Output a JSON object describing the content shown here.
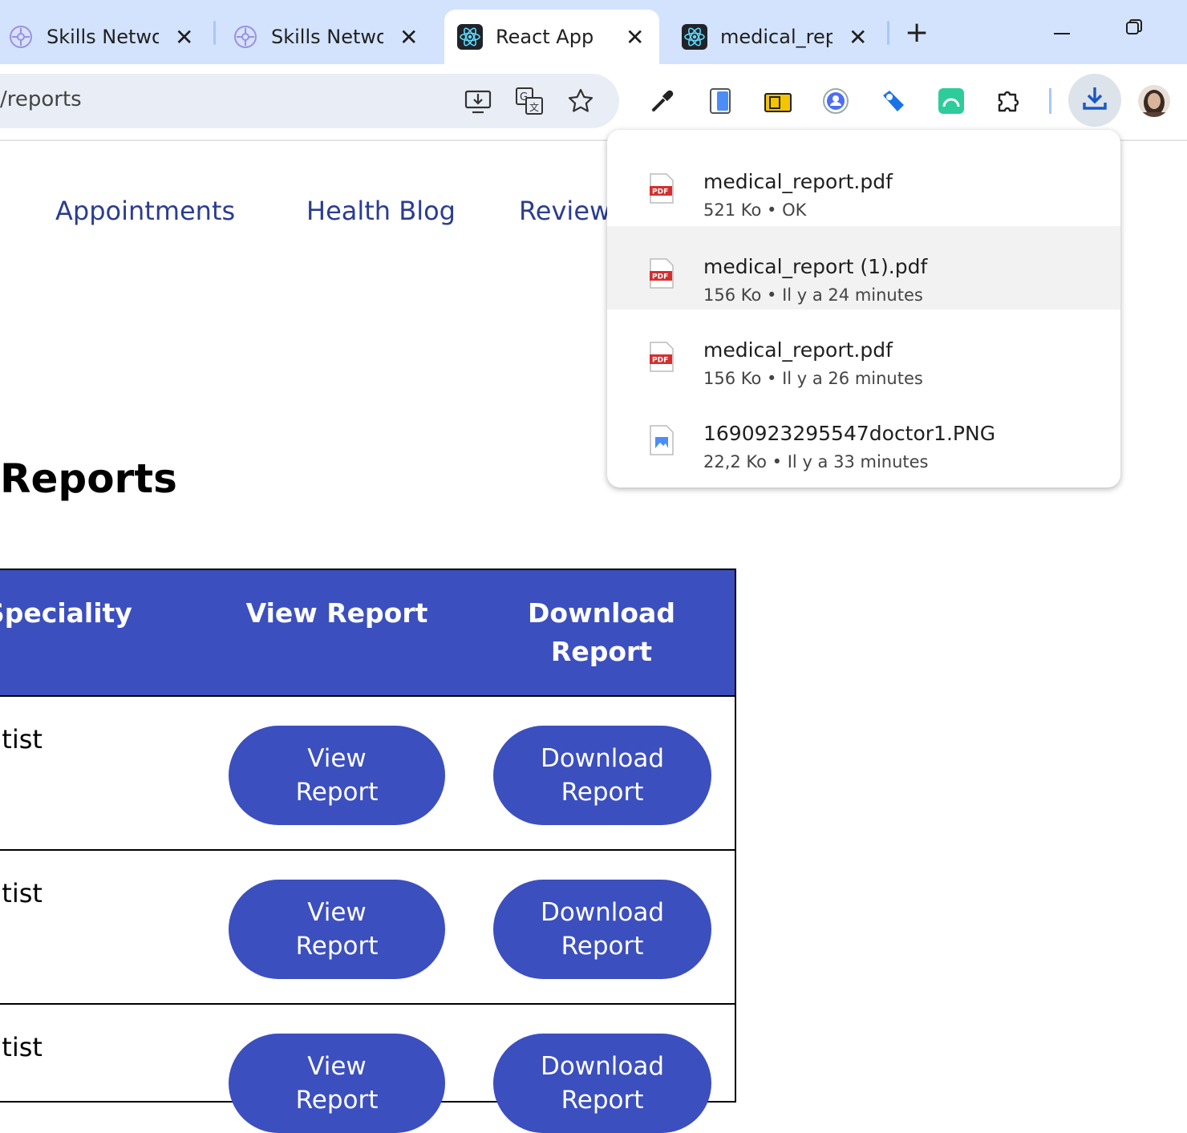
{
  "browser": {
    "tabs": [
      {
        "label": "Skills Networ",
        "icon": "skills-network-icon",
        "active": false
      },
      {
        "label": "Skills Networ",
        "icon": "skills-network-icon",
        "active": false
      },
      {
        "label": "React App",
        "icon": "react-icon",
        "active": true
      },
      {
        "label": "medical_repo",
        "icon": "react-icon",
        "active": false
      }
    ],
    "new_tab_symbol": "+",
    "close_symbol": "✕",
    "address": "/reports"
  },
  "nav": {
    "links": [
      "Appointments",
      "Health Blog",
      "Reviews"
    ]
  },
  "page": {
    "title": "Reports",
    "table": {
      "headers": [
        "Speciality",
        "View Report",
        "Download Report"
      ],
      "rows": [
        {
          "speciality": "ntist",
          "view": "View Report",
          "download": "Download Report"
        },
        {
          "speciality": "ntist",
          "view": "View Report",
          "download": "Download Report"
        },
        {
          "speciality": "ntist",
          "view": "View Report",
          "download": "Download Report"
        }
      ]
    }
  },
  "downloads": {
    "items": [
      {
        "name": "medical_report.pdf",
        "meta": "521 Ko • OK",
        "type": "pdf"
      },
      {
        "name": "medical_report (1).pdf",
        "meta": "156 Ko • Il y a 24 minutes",
        "type": "pdf"
      },
      {
        "name": "medical_report.pdf",
        "meta": "156 Ko • Il y a 26 minutes",
        "type": "pdf"
      },
      {
        "name": "1690923295547doctor1.PNG",
        "meta": "22,2 Ko • Il y a 33 minutes",
        "type": "image"
      }
    ]
  },
  "colors": {
    "accent": "#3c4fbf",
    "nav_link": "#2b3d8f",
    "tabbar": "#d3e3fd"
  }
}
